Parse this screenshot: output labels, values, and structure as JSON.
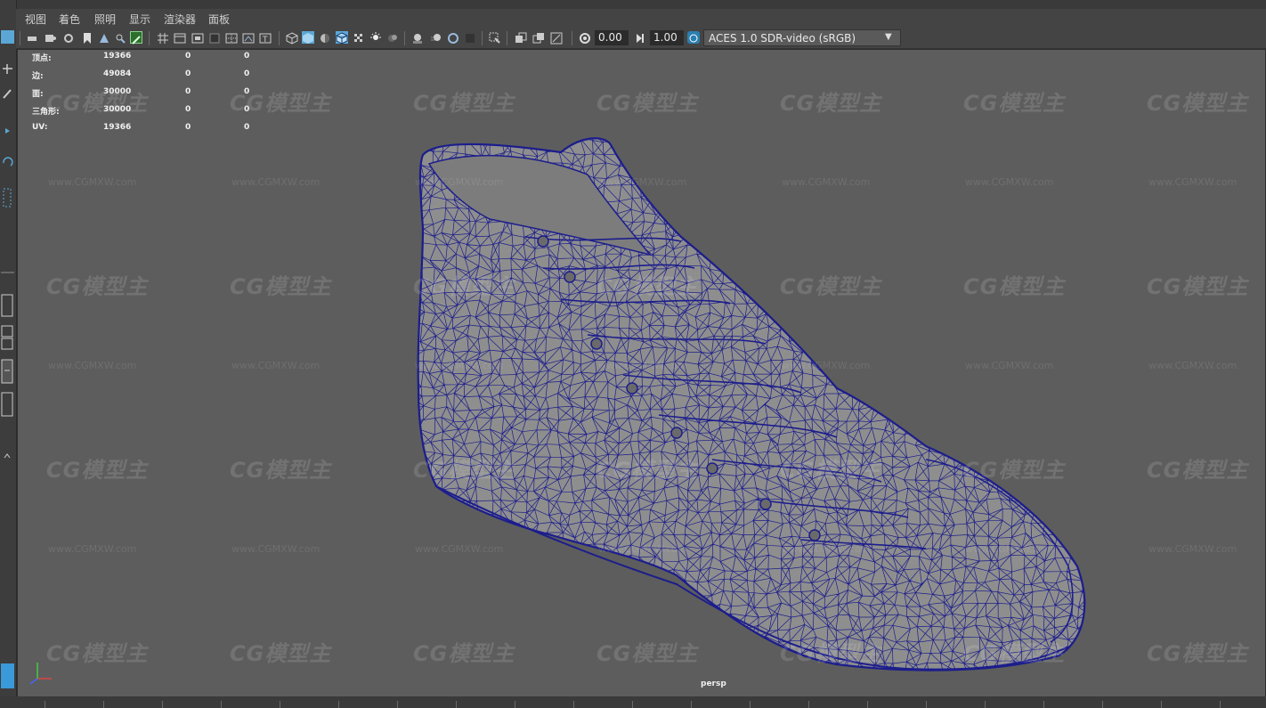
{
  "menu": {
    "items": [
      "视图",
      "着色",
      "照明",
      "显示",
      "渲染器",
      "面板"
    ]
  },
  "toolbar": {
    "exposure_value": "0.00",
    "gamma_value": "1.00",
    "color_space": "ACES 1.0 SDR-video (sRGB)"
  },
  "hud": {
    "rows": [
      {
        "label": "顶点:",
        "value": "19366",
        "c2": "0",
        "c3": "0"
      },
      {
        "label": "边:",
        "value": "49084",
        "c2": "0",
        "c3": "0"
      },
      {
        "label": "面:",
        "value": "30000",
        "c2": "0",
        "c3": "0"
      },
      {
        "label": "三角形:",
        "value": "30000",
        "c2": "0",
        "c3": "0"
      },
      {
        "label": "UV:",
        "value": "19366",
        "c2": "0",
        "c3": "0"
      }
    ]
  },
  "watermark": {
    "logo": "CG模型主",
    "url": "www.CGMXW.com"
  },
  "viewport": {
    "camera": "persp"
  },
  "colors": {
    "wire": "#1c1d8c",
    "mesh": "#8e8e8e",
    "viewport_bg": "#5d5d5d",
    "accent": "#5aa7d6"
  }
}
